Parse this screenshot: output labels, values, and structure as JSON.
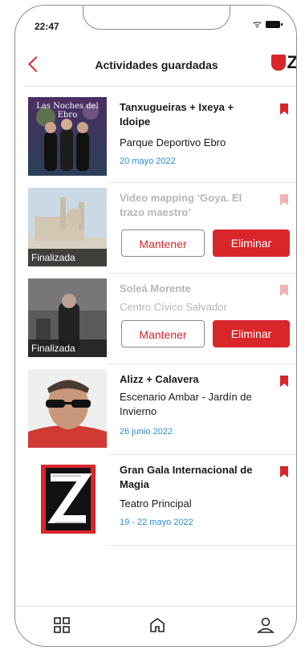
{
  "status": {
    "time": "22:47"
  },
  "header": {
    "title": "Actividades guardadas",
    "logo_text": "Z"
  },
  "items": [
    {
      "name": "Tanxugueiras + Ixeya + Idoipe",
      "place": "Parque Deportivo Ebro",
      "date": "20 mayo 2022",
      "thumb_caption": "Las Noches del Ebro",
      "state": "active"
    },
    {
      "name": "Video mapping ‘Goya. El trazo maestro’",
      "place": "",
      "date": "",
      "badge": "Finalizada",
      "keep_label": "Mantener",
      "delete_label": "Eliminar",
      "state": "finished"
    },
    {
      "name": "Soleá Morente",
      "place": "Centro Cívico Salvador",
      "date": "",
      "badge": "Finalizada",
      "keep_label": "Mantener",
      "delete_label": "Eliminar",
      "state": "finished"
    },
    {
      "name": "Alizz + Calavera",
      "place": "Escenario Ambar - Jardín de Invierno",
      "date": "26 junio 2022",
      "state": "active"
    },
    {
      "name": "Gran Gala Internacional de Magia",
      "place": "Teatro Principal",
      "date": "19 - 22 mayo 2022",
      "state": "active"
    }
  ],
  "icons": {
    "back": "chevron-left-icon",
    "bookmark": "bookmark-icon",
    "nav": [
      "grid-icon",
      "home-icon",
      "user-icon"
    ]
  },
  "colors": {
    "accent": "#d9262b",
    "date": "#2a8bd1"
  }
}
